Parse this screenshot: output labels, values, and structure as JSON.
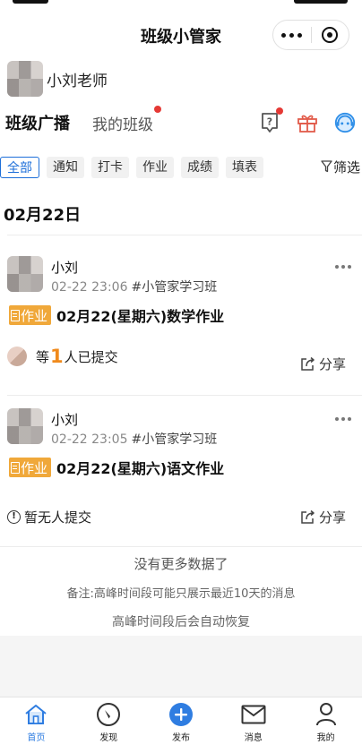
{
  "app": {
    "title": "班级小管家"
  },
  "user": {
    "name": "小刘老师"
  },
  "main_tabs": [
    {
      "label": "班级广播",
      "active": true
    },
    {
      "label": "我的班级",
      "active": false,
      "has_dot": true
    }
  ],
  "tool_icons": [
    "help-icon",
    "gift-icon",
    "customer-service-icon"
  ],
  "filters": {
    "chips": [
      {
        "label": "全部",
        "active": true
      },
      {
        "label": "通知"
      },
      {
        "label": "打卡"
      },
      {
        "label": "作业"
      },
      {
        "label": "成绩"
      },
      {
        "label": "填表"
      }
    ],
    "filter_label": "筛选"
  },
  "date_heading": "02月22日",
  "posts": [
    {
      "poster": "小刘",
      "time": "02-22 23:06",
      "class": "#小管家学习班",
      "type_badge": "作业",
      "title": "02月22(星期六)数学作业",
      "submit_prefix": "等",
      "submit_count": "1",
      "submit_suffix": "人已提交",
      "share_label": "分享"
    },
    {
      "poster": "小刘",
      "time": "02-22 23:05",
      "class": "#小管家学习班",
      "type_badge": "作业",
      "title": "02月22(星期六)语文作业",
      "submit_text": "暂无人提交",
      "share_label": "分享"
    }
  ],
  "footer_notes": {
    "no_more": "没有更多数据了",
    "note": "备注:高峰时间段可能只展示最近10天的消息",
    "restore": "高峰时间段后会自动恢复"
  },
  "bottom_nav": [
    {
      "label": "首页",
      "icon": "home-icon",
      "active": true
    },
    {
      "label": "发现",
      "icon": "compass-icon"
    },
    {
      "label": "发布",
      "icon": "add-circle-icon"
    },
    {
      "label": "消息",
      "icon": "mail-icon"
    },
    {
      "label": "我的",
      "icon": "person-icon"
    }
  ],
  "colors": {
    "accent": "#1e6fd9",
    "badge": "#f0a83a",
    "count": "#f08a1c",
    "dot": "#e53935"
  }
}
